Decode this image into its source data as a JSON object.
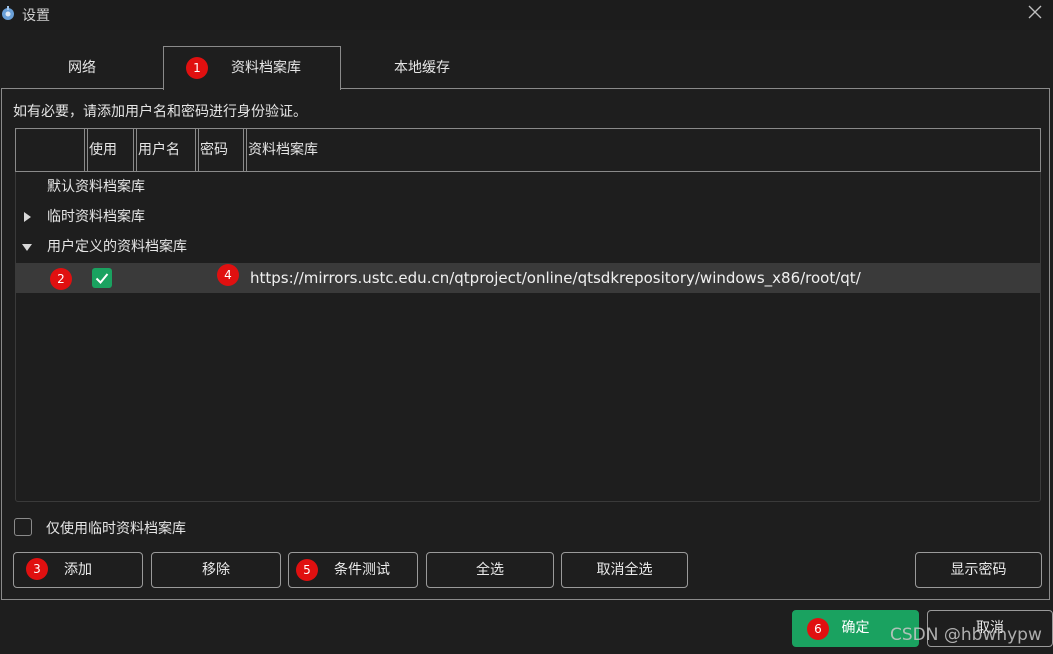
{
  "window": {
    "title": "设置",
    "icon": "settings-app-icon"
  },
  "tabs": [
    {
      "label": "网络"
    },
    {
      "label": "资料档案库",
      "active": true
    },
    {
      "label": "本地缓存"
    }
  ],
  "instruction": "如有必要，请添加用户名和密码进行身份验证。",
  "table": {
    "columns": [
      "",
      "使用",
      "用户名",
      "密码",
      "资料档案库"
    ],
    "groups": [
      {
        "label": "默认资料档案库",
        "expanded": false
      },
      {
        "label": "临时资料档案库",
        "expanded": false
      },
      {
        "label": "用户定义的资料档案库",
        "expanded": true
      }
    ],
    "entries": [
      {
        "use": true,
        "username": "",
        "password": "",
        "url": "https://mirrors.ustc.edu.cn/qtproject/online/qtsdkrepository/windows_x86/root/qt/"
      }
    ]
  },
  "temp_only_label": "仅使用临时资料档案库",
  "buttons": {
    "add": "添加",
    "remove": "移除",
    "test": "条件测试",
    "select_all": "全选",
    "deselect_all": "取消全选",
    "show_password": "显示密码",
    "ok": "确定",
    "cancel": "取消"
  },
  "badges": [
    "1",
    "2",
    "3",
    "4",
    "5",
    "6"
  ],
  "watermark": "CSDN @hbwhypw",
  "colors": {
    "background": "#1e1e1e",
    "accent": "#1aa260",
    "badge": "#e01010",
    "selection": "#3a3a3a"
  }
}
